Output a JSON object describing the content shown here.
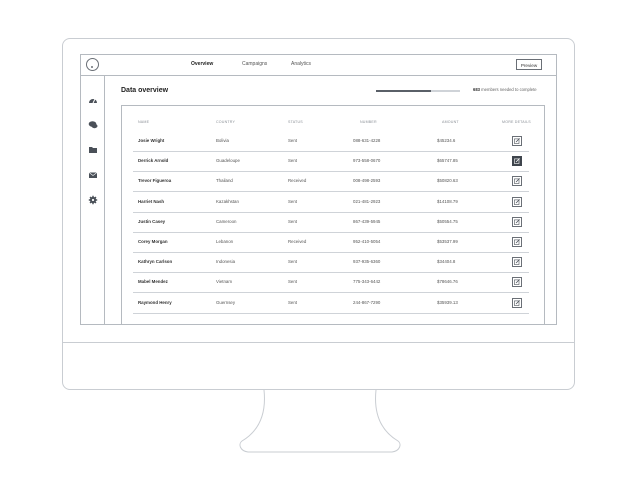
{
  "nav": {
    "links": [
      "Overview",
      "Campaigns",
      "Analytics"
    ],
    "active": "Overview",
    "preview_label": "Preview"
  },
  "sidebar": {
    "icons": [
      "dashboard-icon",
      "chat-icon",
      "folder-icon",
      "mail-icon",
      "gear-icon"
    ]
  },
  "page": {
    "title": "Data overview",
    "progress": {
      "percent": 65,
      "count": "683",
      "text": "members needed to complete"
    }
  },
  "table": {
    "columns": [
      "Name",
      "Country",
      "Status",
      "Number",
      "Amount",
      "More details"
    ],
    "rows": [
      {
        "name": "Josie Wright",
        "country": "Bolivia",
        "status": "Sent",
        "number": "088-631-4228",
        "amount": "$45234.6",
        "selected": false
      },
      {
        "name": "Derrick Arnold",
        "country": "Guadeloupe",
        "status": "Sent",
        "number": "973-558-0670",
        "amount": "$65747.85",
        "selected": true
      },
      {
        "name": "Trevor Figueroa",
        "country": "Thailand",
        "status": "Received",
        "number": "008-498-2593",
        "amount": "$50820.63",
        "selected": false
      },
      {
        "name": "Harriet Nash",
        "country": "Kazakhstan",
        "status": "Sent",
        "number": "021-481-2923",
        "amount": "$14108.79",
        "selected": false
      },
      {
        "name": "Justin Casey",
        "country": "Cameroon",
        "status": "Sent",
        "number": "867-439-5945",
        "amount": "$50554.75",
        "selected": false
      },
      {
        "name": "Corey Morgan",
        "country": "Lebanon",
        "status": "Received",
        "number": "952-410-5054",
        "amount": "$53537.99",
        "selected": false
      },
      {
        "name": "Kathryn Carlson",
        "country": "Indonesia",
        "status": "Sent",
        "number": "937-935-6360",
        "amount": "$34404.8",
        "selected": false
      },
      {
        "name": "Mabel Mendez",
        "country": "Vietnam",
        "status": "Sent",
        "number": "775-343-6442",
        "amount": "$78646.76",
        "selected": false
      },
      {
        "name": "Raymond Henry",
        "country": "Guernsey",
        "status": "Sent",
        "number": "244-867-7290",
        "amount": "$35939.13",
        "selected": false
      }
    ]
  },
  "colors": {
    "accent": "#3f454d",
    "border": "#b5bac0"
  }
}
